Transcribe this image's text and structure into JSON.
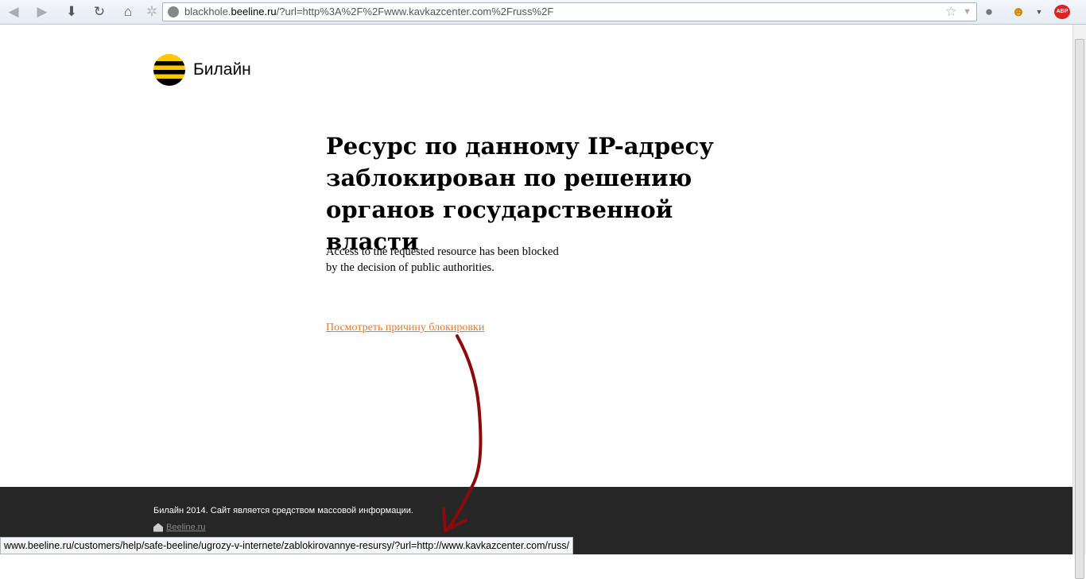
{
  "browser": {
    "url_prefix": "blackhole.",
    "url_domain": "beeline.ru",
    "url_rest": "/?url=http%3A%2F%2Fwww.kavkazcenter.com%2Fruss%2F",
    "addon_label": "ABP"
  },
  "page": {
    "logo_text": "Билайн",
    "heading": "Ресурс по данному IP-адресу заблокирован по решению органов государственной власти",
    "english_line1": "Access to the requested resource has been blocked",
    "english_line2": "by the decision of public authorities.",
    "reason_link": "Посмотреть причину блокировки"
  },
  "footer": {
    "text": "Билайн 2014. Сайт является средством массовой информации.",
    "link": "Beeline.ru"
  },
  "status_bar": {
    "url": "www.beeline.ru/customers/help/safe-beeline/ugrozy-v-internete/zablokirovannye-resursy/?url=http://www.kavkazcenter.com/russ/"
  },
  "colors": {
    "link": "#e8782a",
    "footer_bg": "#262626",
    "brand_yellow": "#fbc800",
    "arrow": "#8b0a0a"
  }
}
